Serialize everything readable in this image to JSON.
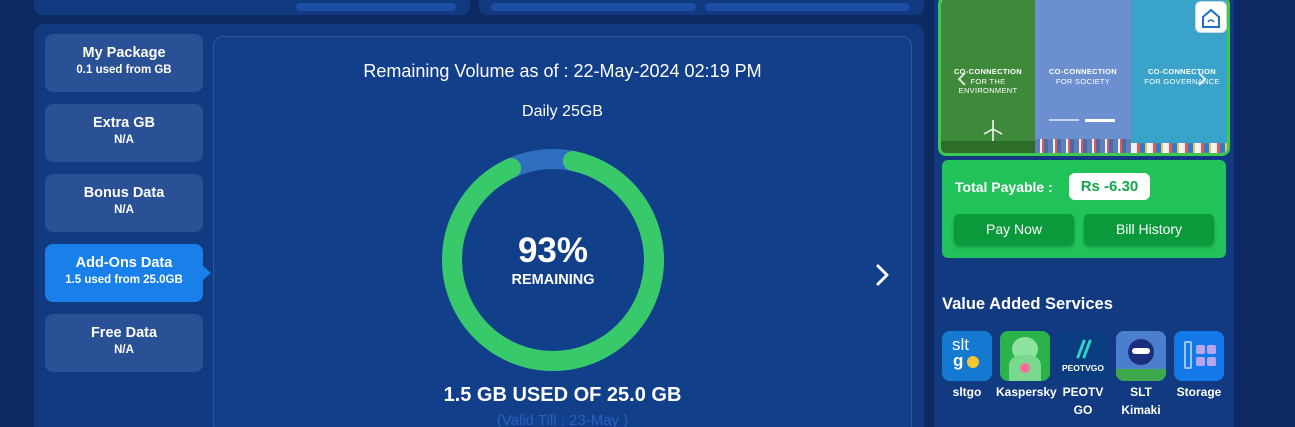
{
  "sidebar": {
    "items": [
      {
        "title": "My Package",
        "subtitle": "0.1 used from GB",
        "active": false
      },
      {
        "title": "Extra GB",
        "subtitle": "N/A",
        "active": false
      },
      {
        "title": "Bonus Data",
        "subtitle": "N/A",
        "active": false
      },
      {
        "title": "Add-Ons Data",
        "subtitle": "1.5 used from 25.0GB",
        "active": true
      },
      {
        "title": "Free Data",
        "subtitle": "N/A",
        "active": false
      }
    ]
  },
  "usage": {
    "title": "Remaining Volume as of : 22-May-2024 02:19 PM",
    "package": "Daily 25GB",
    "percent": "93%",
    "percent_label": "REMAINING",
    "remaining_fraction": 0.93,
    "used_text": "1.5 GB USED OF 25.0 GB",
    "valid_text": "(Valid Till : 23-May )",
    "colors": {
      "remaining": "#37c96a",
      "used": "#2f6fc0"
    }
  },
  "banner": {
    "panels": [
      {
        "title": "CO-CONNECTION",
        "subtitle": "FOR THE ENVIRONMENT",
        "color": "#3f8a3a"
      },
      {
        "title": "CO-CONNECTION",
        "subtitle": "FOR SOCIETY",
        "color": "#6c8fcf"
      },
      {
        "title": "CO-CONNECTION",
        "subtitle": "FOR GOVERNANCE",
        "color": "#3aa3c9"
      }
    ]
  },
  "billing": {
    "label": "Total Payable :",
    "amount": "Rs -6.30",
    "pay_now": "Pay Now",
    "bill_history": "Bill History"
  },
  "vas": {
    "title": "Value Added Services",
    "items": [
      {
        "label": "sltgo",
        "icon": "sltgo-icon",
        "color": "#1479d1"
      },
      {
        "label": "Kaspersky",
        "icon": "kaspersky-icon",
        "color": "#2cb24a"
      },
      {
        "label": "PEOTV GO",
        "icon": "peotv-go-icon",
        "color": "#0a3c80"
      },
      {
        "label": "SLT Kimaki",
        "icon": "slt-kimaki-icon",
        "color": "#4a7fd0"
      },
      {
        "label": "Storage",
        "icon": "storage-icon",
        "color": "#1479e8"
      }
    ]
  }
}
